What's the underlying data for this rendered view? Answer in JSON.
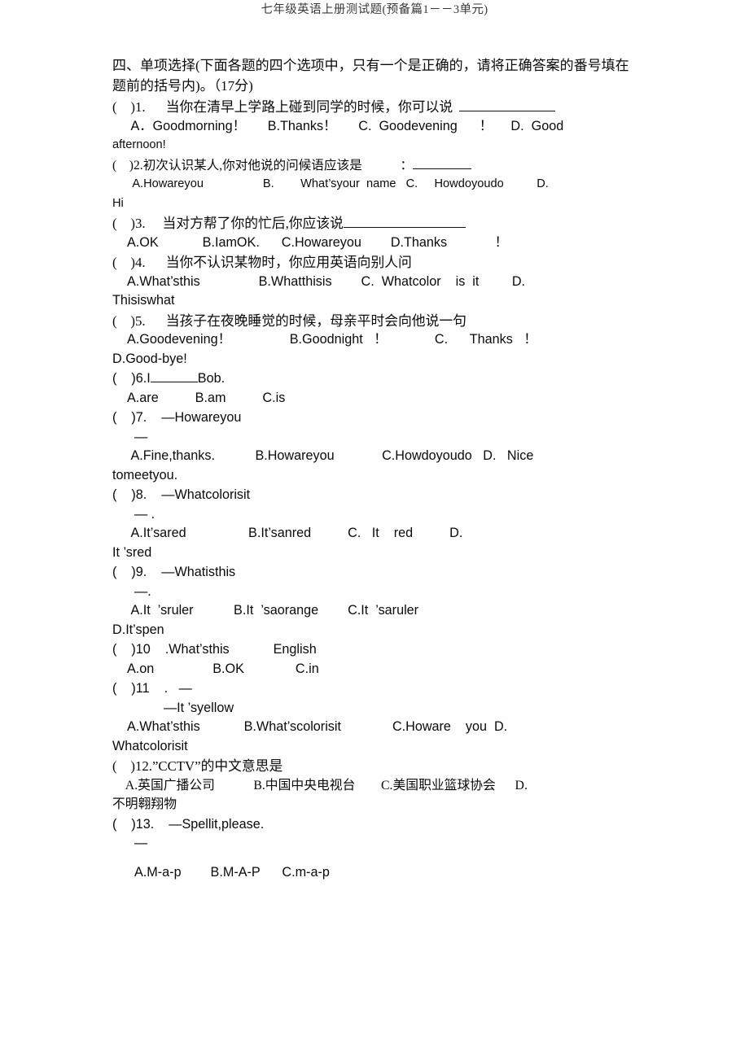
{
  "document": {
    "running_header": "七年级英语上册测试题(预备篇1－－3单元)",
    "instruction": "四、单项选择(下面各题的四个选项中，只有一个是正确的，请将正确答案的番号填在题前的括号内)。（17分)"
  },
  "questions": [
    {
      "number": "1",
      "marker": "(    )1.",
      "stem": "当你在清早上学路上碰到同学的时候，你可以说",
      "stem_has_blank": true,
      "options_line": "A．Goodmorning！      B.Thanks！      C.  Goodevening      ！     D.  Good",
      "options_wrap": "afternoon!"
    },
    {
      "number": "2",
      "marker": "(    )2.",
      "stem": "初次认识某人,你对他说的问候语应该是",
      "stem_tail": "：",
      "stem_has_blank": true,
      "options_line": "A.Howareyou                  B.        What’syour  name   C.     Howdoyoudo          D.",
      "options_wrap": "Hi"
    },
    {
      "number": "3",
      "marker": "(    )3.",
      "stem": "当对方帮了你的忙后,你应该说",
      "stem_has_blank": true,
      "options_line": "A.OK            B.IamOK.      C.Howareyou        D.Thanks             ！"
    },
    {
      "number": "4",
      "marker": "(    )4.",
      "stem": "当你不认识某物时，你应用英语向别人问",
      "options_line": "A.What’sthis                B.Whatthisis        C.  Whatcolor    is  it         D.",
      "options_wrap": "Thisiswhat"
    },
    {
      "number": "5",
      "marker": "(    )5.",
      "stem": "当孩子在夜晚睡觉的时候，母亲平时会向他说一句",
      "options_line": "A.Goodevening！                B.Goodnight   ！             C.      Thanks   ！",
      "options_wrap": "D.Good-bye!"
    },
    {
      "number": "6",
      "marker": "(    )6.I",
      "stem_tail": "Bob.",
      "stem_has_blank": true,
      "options_line": "A.are          B.am          C.is"
    },
    {
      "number": "7",
      "marker": "(    )7.",
      "stem": "—Howareyou",
      "stem_second_line": "—",
      "options_line": "A.Fine,thanks.           B.Howareyou             C.Howdoyoudo   D.   Nice",
      "options_wrap": "tomeetyou."
    },
    {
      "number": "8",
      "marker": "(    )8.",
      "stem": "—Whatcolorisit",
      "stem_second_line": "—                .",
      "options_line": "A.It’sared                 B.It’sanred          C.   It    red          D.",
      "options_wrap": "It ’sred"
    },
    {
      "number": "9",
      "marker": "(    )9.",
      "stem": "—Whatisthis",
      "stem_second_line": "—.",
      "options_line": "A.It  ’sruler           B.It  ’saorange        C.It  ’saruler",
      "options_wrap": "D.It’spen"
    },
    {
      "number": "10",
      "marker": "(    )10",
      "stem": ".What’sthis            English",
      "options_line": "A.on                B.OK              C.in"
    },
    {
      "number": "11",
      "marker": "(    )11",
      "stem": ".   —",
      "stem_second_line": "—It      ’syellow",
      "options_line": "A.What’sthis            B.What’scolorisit              C.Howare    you  D.",
      "options_wrap": "Whatcolorisit"
    },
    {
      "number": "12",
      "marker": "(    )12.",
      "stem": "”CCTV”的中文意思是",
      "options_line": "A.英国广播公司            B.中国中央电视台        C.美国职业篮球协会      D.",
      "options_wrap": "不明翱翔物"
    },
    {
      "number": "13",
      "marker": "(    )13.",
      "stem": "—Spellit,please.",
      "stem_second_line": "—",
      "options_line": "A.M-a-p        B.M-A-P      C.m-a-p"
    }
  ]
}
